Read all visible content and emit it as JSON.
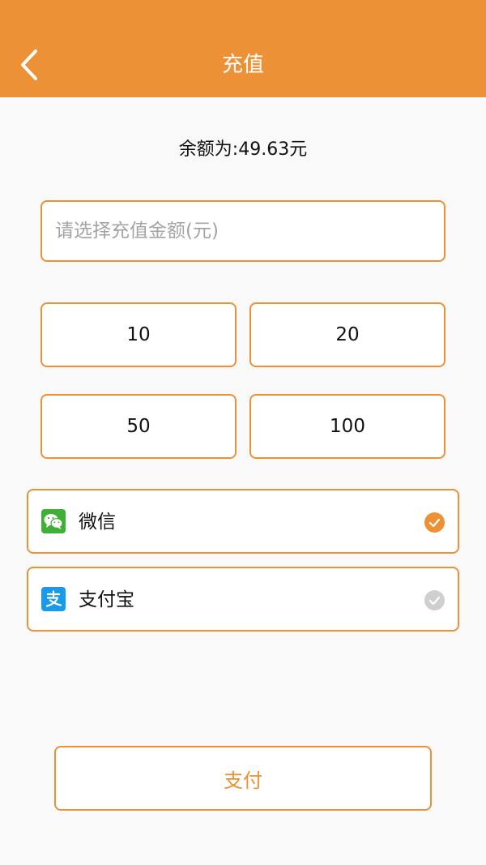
{
  "header": {
    "title": "充值",
    "back_icon": "chevron-left-icon",
    "bg_color": "#ec9135"
  },
  "balance": {
    "text": "余额为:49.63元"
  },
  "amount_input": {
    "value": "",
    "placeholder": "请选择充值金额(元)"
  },
  "amount_options": [
    "10",
    "20",
    "50",
    "100"
  ],
  "payment_methods": [
    {
      "label": "微信",
      "icon": "wechat-icon",
      "selected": true,
      "icon_color": "#3db035"
    },
    {
      "label": "支付宝",
      "icon": "alipay-icon",
      "selected": false,
      "icon_color": "#1a9bea"
    }
  ],
  "submit": {
    "label": "支付"
  },
  "colors": {
    "accent": "#ec9135",
    "radio_off": "#cfcfcf"
  }
}
